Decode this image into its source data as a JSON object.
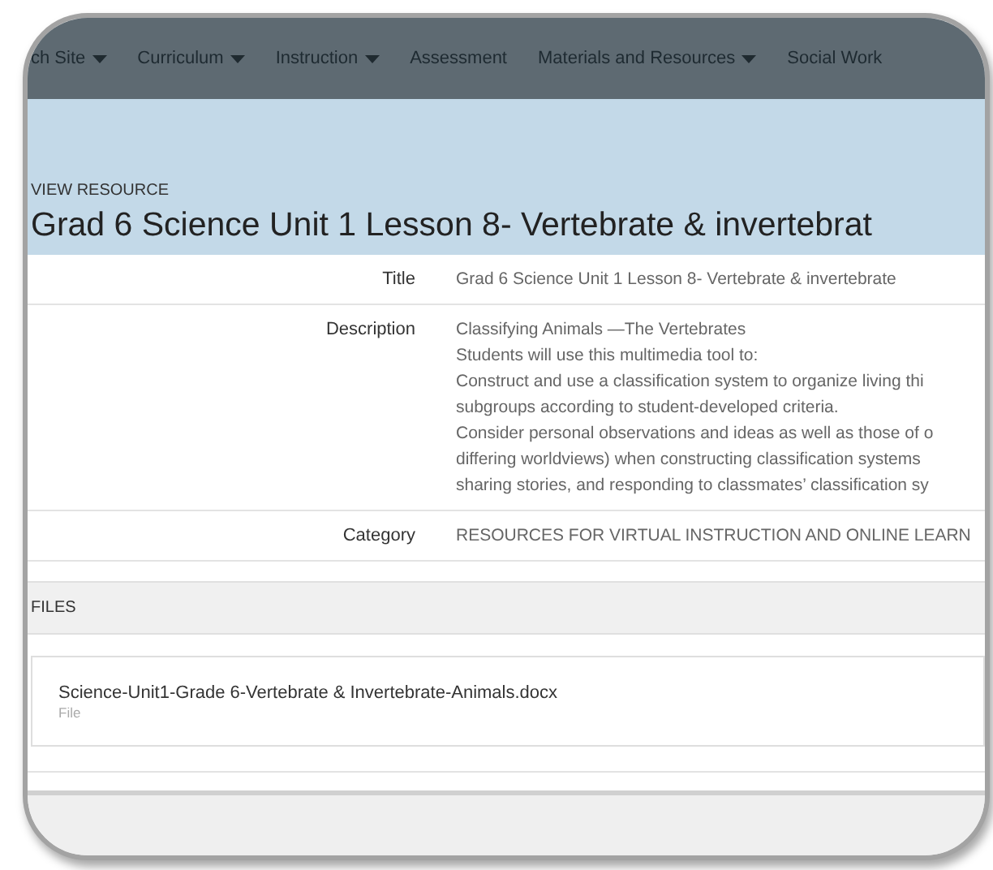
{
  "nav": [
    {
      "label": "ch Site",
      "dropdown": true
    },
    {
      "label": "Curriculum",
      "dropdown": true
    },
    {
      "label": "Instruction",
      "dropdown": true
    },
    {
      "label": "Assessment",
      "dropdown": false
    },
    {
      "label": "Materials and Resources",
      "dropdown": true
    },
    {
      "label": "Social Work",
      "dropdown": false
    }
  ],
  "header": {
    "eyebrow": "VIEW RESOURCE",
    "title": "Grad 6 Science Unit 1 Lesson 8- Vertebrate & invertebrat"
  },
  "details": [
    {
      "label": "Title",
      "lines": [
        "Grad 6 Science Unit 1 Lesson 8- Vertebrate & invertebrate"
      ]
    },
    {
      "label": "Description",
      "lines": [
        "Classifying Animals —The Vertebrates",
        "Students will use this multimedia tool to:",
        "Construct and use a classification system to organize living thi",
        "subgroups according to student-developed criteria.",
        "Consider personal observations and ideas as well as those of o",
        "differing worldviews) when constructing classification systems",
        "sharing stories, and responding to classmates’ classification sy"
      ]
    },
    {
      "label": "Category",
      "lines": [
        "RESOURCES FOR VIRTUAL INSTRUCTION AND ONLINE LEARN"
      ]
    }
  ],
  "files": {
    "heading": "FILES",
    "items": [
      {
        "name": "Science-Unit1-Grade 6-Vertebrate & Invertebrate-Animals.docx",
        "type": "File"
      }
    ]
  }
}
